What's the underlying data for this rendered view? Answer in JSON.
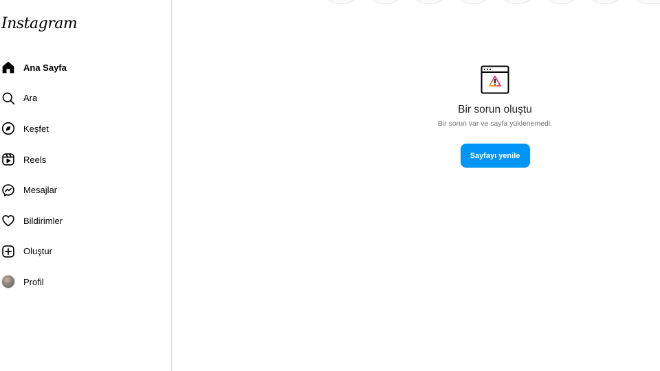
{
  "app": {
    "logo_text": "Instagram"
  },
  "sidebar": {
    "items": [
      {
        "label": "Ana Sayfa",
        "icon": "home-icon",
        "active": true
      },
      {
        "label": "Ara",
        "icon": "search-icon"
      },
      {
        "label": "Keşfet",
        "icon": "compass-icon"
      },
      {
        "label": "Reels",
        "icon": "reels-icon"
      },
      {
        "label": "Mesajlar",
        "icon": "messenger-icon"
      },
      {
        "label": "Bildirimler",
        "icon": "heart-icon"
      },
      {
        "label": "Oluştur",
        "icon": "plus-square-icon"
      },
      {
        "label": "Profil",
        "icon": "avatar"
      }
    ]
  },
  "error": {
    "icon": "browser-warning-icon",
    "title": "Bir sorun oluştu",
    "subtitle": "Bir sorun var ve sayfa yüklenemedi.",
    "button_label": "Sayfayı yenile"
  },
  "colors": {
    "accent": "#0095f6",
    "text": "#262626",
    "muted": "#737373",
    "border": "#dbdbdb"
  }
}
